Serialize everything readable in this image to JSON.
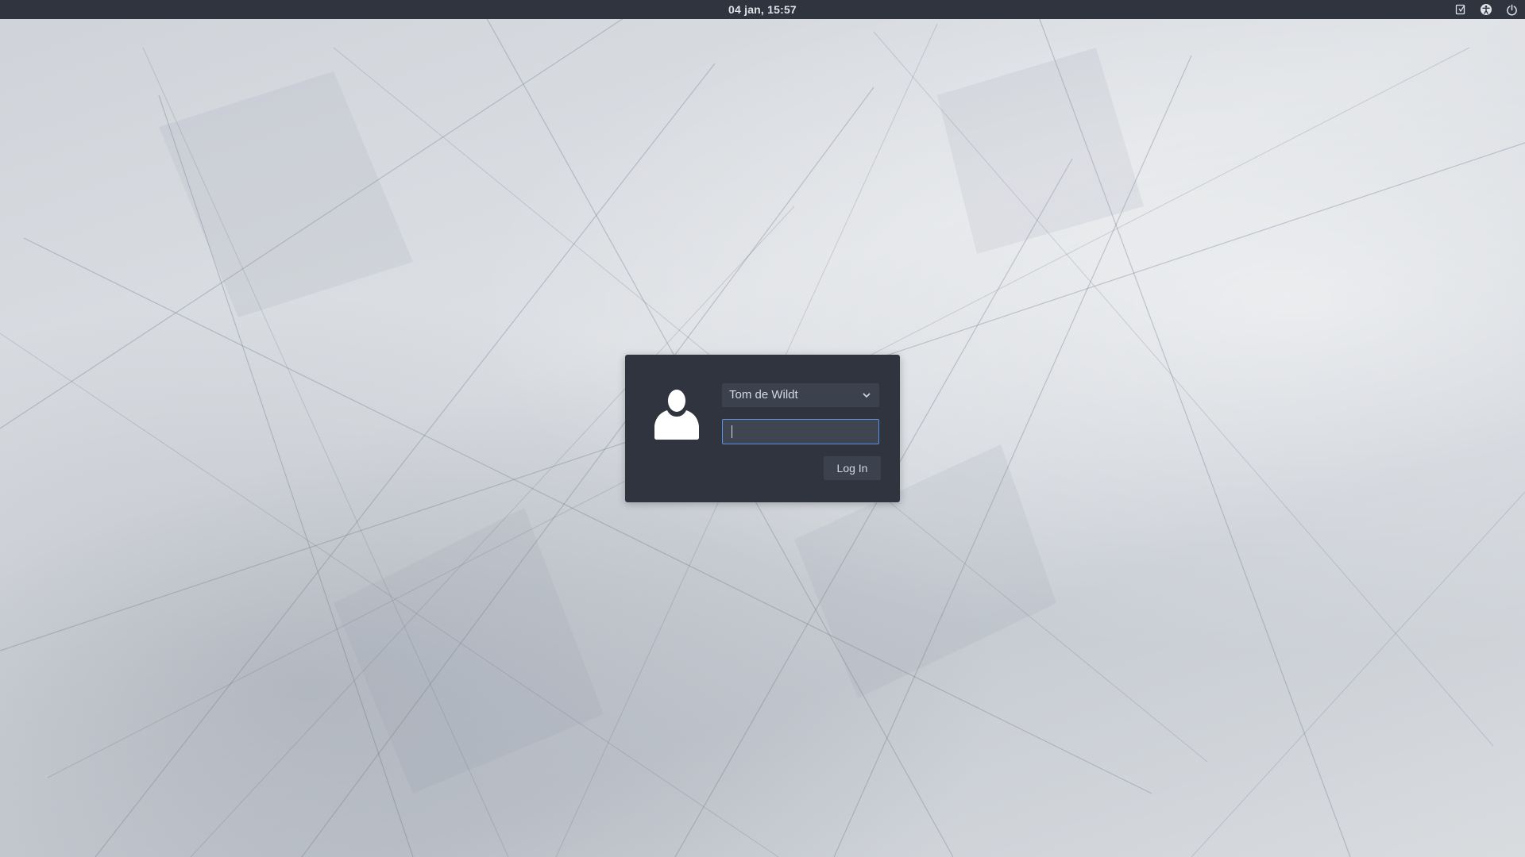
{
  "top_panel": {
    "clock": "04 jan, 15:57",
    "indicators": [
      {
        "icon": "keyboard-layout-icon"
      },
      {
        "icon": "accessibility-icon"
      },
      {
        "icon": "power-icon"
      }
    ]
  },
  "login": {
    "selected_user": "Tom de Wildt",
    "password_value": "",
    "login_label": "Log In",
    "avatar_icon": "user-avatar-icon"
  },
  "colors": {
    "panel_bg": "#2f343f",
    "dialog_bg": "#2f343f",
    "accent": "#5294e2",
    "text": "#d3dae3"
  }
}
